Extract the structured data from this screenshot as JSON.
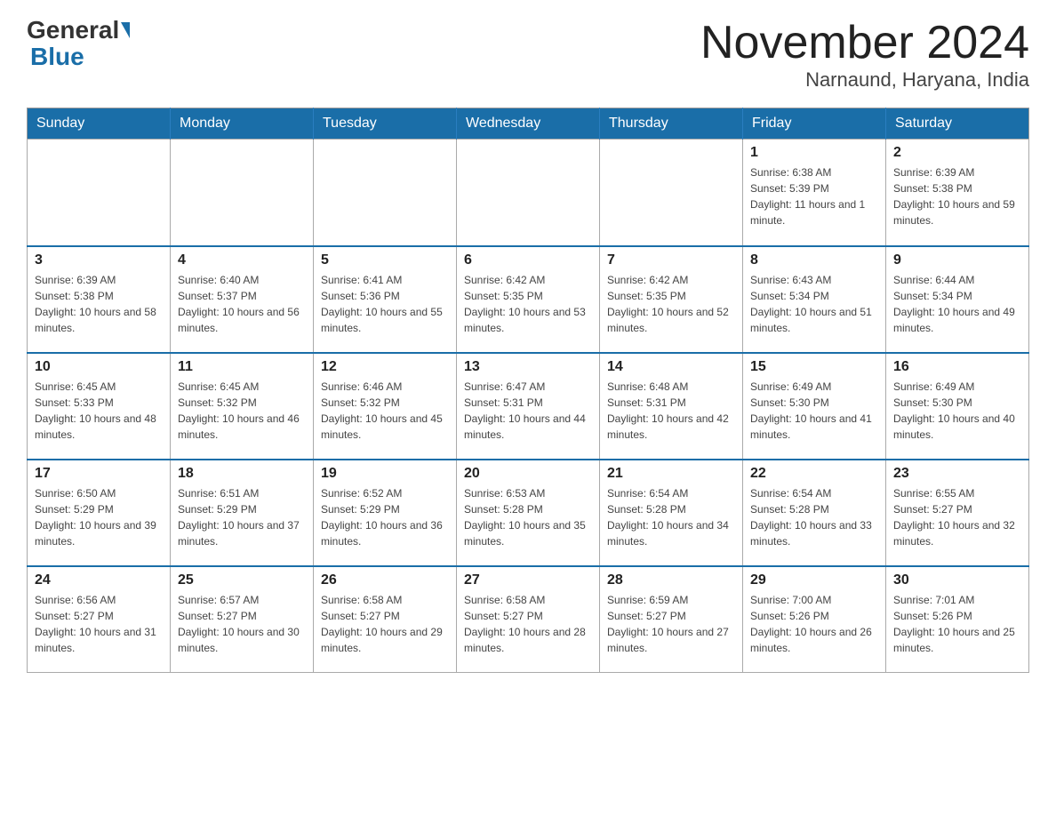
{
  "header": {
    "logo_general": "General",
    "logo_blue": "Blue",
    "month_title": "November 2024",
    "location": "Narnaund, Haryana, India"
  },
  "days_of_week": [
    "Sunday",
    "Monday",
    "Tuesday",
    "Wednesday",
    "Thursday",
    "Friday",
    "Saturday"
  ],
  "weeks": [
    [
      {
        "day": "",
        "info": ""
      },
      {
        "day": "",
        "info": ""
      },
      {
        "day": "",
        "info": ""
      },
      {
        "day": "",
        "info": ""
      },
      {
        "day": "",
        "info": ""
      },
      {
        "day": "1",
        "info": "Sunrise: 6:38 AM\nSunset: 5:39 PM\nDaylight: 11 hours and 1 minute."
      },
      {
        "day": "2",
        "info": "Sunrise: 6:39 AM\nSunset: 5:38 PM\nDaylight: 10 hours and 59 minutes."
      }
    ],
    [
      {
        "day": "3",
        "info": "Sunrise: 6:39 AM\nSunset: 5:38 PM\nDaylight: 10 hours and 58 minutes."
      },
      {
        "day": "4",
        "info": "Sunrise: 6:40 AM\nSunset: 5:37 PM\nDaylight: 10 hours and 56 minutes."
      },
      {
        "day": "5",
        "info": "Sunrise: 6:41 AM\nSunset: 5:36 PM\nDaylight: 10 hours and 55 minutes."
      },
      {
        "day": "6",
        "info": "Sunrise: 6:42 AM\nSunset: 5:35 PM\nDaylight: 10 hours and 53 minutes."
      },
      {
        "day": "7",
        "info": "Sunrise: 6:42 AM\nSunset: 5:35 PM\nDaylight: 10 hours and 52 minutes."
      },
      {
        "day": "8",
        "info": "Sunrise: 6:43 AM\nSunset: 5:34 PM\nDaylight: 10 hours and 51 minutes."
      },
      {
        "day": "9",
        "info": "Sunrise: 6:44 AM\nSunset: 5:34 PM\nDaylight: 10 hours and 49 minutes."
      }
    ],
    [
      {
        "day": "10",
        "info": "Sunrise: 6:45 AM\nSunset: 5:33 PM\nDaylight: 10 hours and 48 minutes."
      },
      {
        "day": "11",
        "info": "Sunrise: 6:45 AM\nSunset: 5:32 PM\nDaylight: 10 hours and 46 minutes."
      },
      {
        "day": "12",
        "info": "Sunrise: 6:46 AM\nSunset: 5:32 PM\nDaylight: 10 hours and 45 minutes."
      },
      {
        "day": "13",
        "info": "Sunrise: 6:47 AM\nSunset: 5:31 PM\nDaylight: 10 hours and 44 minutes."
      },
      {
        "day": "14",
        "info": "Sunrise: 6:48 AM\nSunset: 5:31 PM\nDaylight: 10 hours and 42 minutes."
      },
      {
        "day": "15",
        "info": "Sunrise: 6:49 AM\nSunset: 5:30 PM\nDaylight: 10 hours and 41 minutes."
      },
      {
        "day": "16",
        "info": "Sunrise: 6:49 AM\nSunset: 5:30 PM\nDaylight: 10 hours and 40 minutes."
      }
    ],
    [
      {
        "day": "17",
        "info": "Sunrise: 6:50 AM\nSunset: 5:29 PM\nDaylight: 10 hours and 39 minutes."
      },
      {
        "day": "18",
        "info": "Sunrise: 6:51 AM\nSunset: 5:29 PM\nDaylight: 10 hours and 37 minutes."
      },
      {
        "day": "19",
        "info": "Sunrise: 6:52 AM\nSunset: 5:29 PM\nDaylight: 10 hours and 36 minutes."
      },
      {
        "day": "20",
        "info": "Sunrise: 6:53 AM\nSunset: 5:28 PM\nDaylight: 10 hours and 35 minutes."
      },
      {
        "day": "21",
        "info": "Sunrise: 6:54 AM\nSunset: 5:28 PM\nDaylight: 10 hours and 34 minutes."
      },
      {
        "day": "22",
        "info": "Sunrise: 6:54 AM\nSunset: 5:28 PM\nDaylight: 10 hours and 33 minutes."
      },
      {
        "day": "23",
        "info": "Sunrise: 6:55 AM\nSunset: 5:27 PM\nDaylight: 10 hours and 32 minutes."
      }
    ],
    [
      {
        "day": "24",
        "info": "Sunrise: 6:56 AM\nSunset: 5:27 PM\nDaylight: 10 hours and 31 minutes."
      },
      {
        "day": "25",
        "info": "Sunrise: 6:57 AM\nSunset: 5:27 PM\nDaylight: 10 hours and 30 minutes."
      },
      {
        "day": "26",
        "info": "Sunrise: 6:58 AM\nSunset: 5:27 PM\nDaylight: 10 hours and 29 minutes."
      },
      {
        "day": "27",
        "info": "Sunrise: 6:58 AM\nSunset: 5:27 PM\nDaylight: 10 hours and 28 minutes."
      },
      {
        "day": "28",
        "info": "Sunrise: 6:59 AM\nSunset: 5:27 PM\nDaylight: 10 hours and 27 minutes."
      },
      {
        "day": "29",
        "info": "Sunrise: 7:00 AM\nSunset: 5:26 PM\nDaylight: 10 hours and 26 minutes."
      },
      {
        "day": "30",
        "info": "Sunrise: 7:01 AM\nSunset: 5:26 PM\nDaylight: 10 hours and 25 minutes."
      }
    ]
  ]
}
